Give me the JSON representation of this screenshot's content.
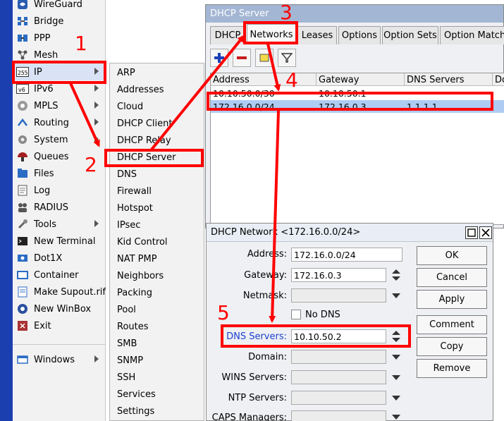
{
  "left_menu": {
    "items": [
      {
        "label": "WireGuard",
        "icon": "wireguard-icon"
      },
      {
        "label": "Bridge",
        "icon": "bridge-icon"
      },
      {
        "label": "PPP",
        "icon": "ppp-icon"
      },
      {
        "label": "Mesh",
        "icon": "mesh-icon"
      },
      {
        "label": "IP",
        "icon": "ip-icon"
      },
      {
        "label": "IPv6",
        "icon": "ipv6-icon"
      },
      {
        "label": "MPLS",
        "icon": "mpls-icon"
      },
      {
        "label": "Routing",
        "icon": "routing-icon"
      },
      {
        "label": "System",
        "icon": "system-icon"
      },
      {
        "label": "Queues",
        "icon": "queues-icon"
      },
      {
        "label": "Files",
        "icon": "files-icon"
      },
      {
        "label": "Log",
        "icon": "log-icon"
      },
      {
        "label": "RADIUS",
        "icon": "radius-icon"
      },
      {
        "label": "Tools",
        "icon": "tools-icon"
      },
      {
        "label": "New Terminal",
        "icon": "terminal-icon"
      },
      {
        "label": "Dot1X",
        "icon": "dot1x-icon"
      },
      {
        "label": "Container",
        "icon": "container-icon"
      },
      {
        "label": "Make Supout.rif",
        "icon": "supout-icon"
      },
      {
        "label": "New WinBox",
        "icon": "winbox-icon"
      },
      {
        "label": "Exit",
        "icon": "exit-icon"
      }
    ],
    "windows_label": "Windows"
  },
  "ip_submenu": {
    "items": [
      "ARP",
      "Addresses",
      "Cloud",
      "DHCP Client",
      "DHCP Relay",
      "DHCP Server",
      "DNS",
      "Firewall",
      "Hotspot",
      "IPsec",
      "Kid Control",
      "NAT PMP",
      "Neighbors",
      "Packing",
      "Pool",
      "Routes",
      "SMB",
      "SNMP",
      "SSH",
      "Services",
      "Settings"
    ]
  },
  "dhcp_server_window": {
    "title": "DHCP Server",
    "tabs": [
      "DHCP",
      "Networks",
      "Leases",
      "Options",
      "Option Sets",
      "Option Matcher"
    ],
    "active_tab": "Networks",
    "columns": [
      "Address",
      "Gateway",
      "DNS Servers",
      "Do"
    ],
    "rows": [
      {
        "address": "10.10.50.0/30",
        "gateway": "10.10.50.1",
        "dns": ""
      },
      {
        "address": "172.16.0.0/24",
        "gateway": "172.16.0.3",
        "dns": "1.1.1.1"
      }
    ]
  },
  "dhcp_network_dialog": {
    "title": "DHCP Network <172.16.0.0/24>",
    "labels": {
      "address": "Address:",
      "gateway": "Gateway:",
      "netmask": "Netmask:",
      "no_dns": "No DNS",
      "dns_servers": "DNS Servers:",
      "domain": "Domain:",
      "wins": "WINS Servers:",
      "ntp": "NTP Servers:",
      "caps": "CAPS Managers:"
    },
    "values": {
      "address": "172.16.0.0/24",
      "gateway": "172.16.0.3",
      "dns_servers": "10.10.50.2"
    },
    "buttons": [
      "OK",
      "Cancel",
      "Apply",
      "Comment",
      "Copy",
      "Remove"
    ]
  },
  "annotations": {
    "step_numbers": [
      "1",
      "2",
      "3",
      "4",
      "5"
    ],
    "color": "#ff0000"
  }
}
